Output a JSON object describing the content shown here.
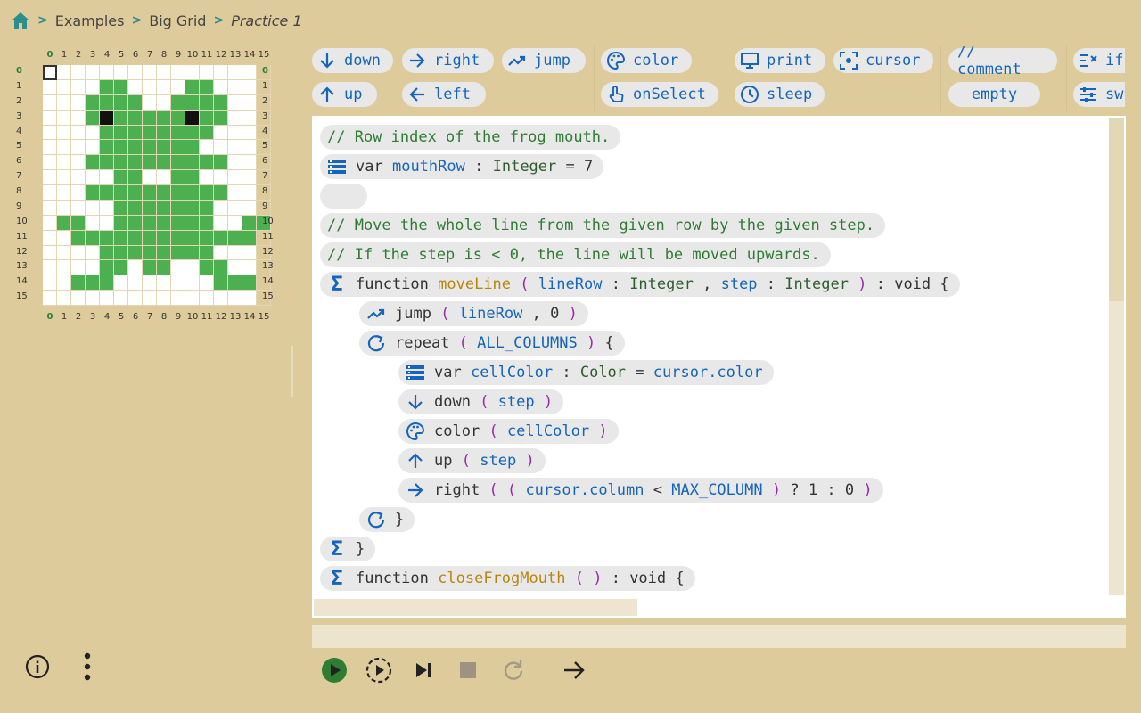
{
  "breadcrumb": {
    "items": [
      "Examples",
      "Big Grid"
    ],
    "current": "Practice 1"
  },
  "grid": {
    "columns": [
      "0",
      "1",
      "2",
      "3",
      "4",
      "5",
      "6",
      "7",
      "8",
      "9",
      "10",
      "11",
      "12",
      "13",
      "14",
      "15"
    ],
    "rows": [
      "0",
      "1",
      "2",
      "3",
      "4",
      "5",
      "6",
      "7",
      "8",
      "9",
      "10",
      "11",
      "12",
      "13",
      "14",
      "15"
    ],
    "pattern": [
      "................",
      "....gg....gg....",
      "...gggg..gggg...",
      "...gkgggggkgg...",
      "....gggggggg....",
      "....ggggggg.....",
      "...gggggggggg...",
      ".....gg..gg.....",
      "...gggggggggg...",
      ".....ggggggg....",
      ".gg..ggggggg..gg",
      "..ggggggggggggg.",
      "....gggggggg....",
      "....gg.gg..gg...",
      "..ggg.......ggg.",
      "................"
    ],
    "colors": {
      "green": "#4caf50",
      "black": "#111111",
      "empty": "#ffffff"
    },
    "cursor": {
      "row": 0,
      "column": 0
    }
  },
  "palette": {
    "row1": [
      {
        "label": "down",
        "icon": "arrow-down-icon"
      },
      {
        "label": "right",
        "icon": "arrow-right-icon"
      },
      {
        "label": "jump",
        "icon": "jump-icon"
      },
      {
        "label": "color",
        "icon": "palette-icon"
      },
      {
        "label": "print",
        "icon": "monitor-icon"
      },
      {
        "label": "cursor",
        "icon": "cursor-focus-icon"
      },
      {
        "label": "// comment",
        "icon": ""
      },
      {
        "label": "if",
        "icon": "condition-icon"
      }
    ],
    "row2": [
      {
        "label": "up",
        "icon": "arrow-up-icon"
      },
      {
        "label": "left",
        "icon": "arrow-left-icon"
      },
      {
        "label": "onSelect",
        "icon": "touch-icon"
      },
      {
        "label": "sleep",
        "icon": "clock-icon"
      },
      {
        "label": "empty",
        "icon": ""
      },
      {
        "label": "sw",
        "icon": "switch-icon"
      }
    ]
  },
  "code": {
    "l1": "// Row index of the frog mouth.",
    "l2": {
      "kw": "var",
      "name": "mouthRow",
      "colon": ":",
      "type": "Integer",
      "eq": "=",
      "value": "7"
    },
    "l4": "// Move the whole line from the given row by the given step.",
    "l5": "// If the step is < 0, the line will be moved upwards.",
    "l6": {
      "kw": "function",
      "name": "moveLine",
      "p1": "lineRow",
      "t1": "Integer",
      "comma": ",",
      "p2": "step",
      "t2": "Integer",
      "ret": "void",
      "brace": "{",
      "open": "(",
      "close": ")",
      "colon": ":"
    },
    "l7": {
      "kw": "jump",
      "arg1": "lineRow",
      "comma": ",",
      "arg2": "0",
      "open": "(",
      "close": ")"
    },
    "l8": {
      "kw": "repeat",
      "arg": "ALL_COLUMNS",
      "open": "(",
      "close": ")",
      "brace": "{"
    },
    "l9": {
      "kw": "var",
      "name": "cellColor",
      "colon": ":",
      "type": "Color",
      "eq": "=",
      "value": "cursor.color"
    },
    "l10": {
      "kw": "down",
      "arg": "step",
      "open": "(",
      "close": ")"
    },
    "l11": {
      "kw": "color",
      "arg": "cellColor",
      "open": "(",
      "close": ")"
    },
    "l12": {
      "kw": "up",
      "arg": "step",
      "open": "(",
      "close": ")"
    },
    "l13": {
      "kw": "right",
      "a": "cursor.column",
      "op": "<",
      "b": "MAX_COLUMN",
      "q": "?",
      "one": "1",
      "c": ":",
      "zero": "0",
      "open": "(",
      "close": ")"
    },
    "l14": "}",
    "l15": "}",
    "l16": {
      "kw": "function",
      "name": "closeFrogMouth",
      "open": "(",
      "close": ")",
      "colon": ":",
      "ret": "void",
      "brace": "{"
    }
  },
  "accent": {
    "teal": "#2a8f8a",
    "green": "#2e7d32",
    "blue": "#1565c0"
  }
}
